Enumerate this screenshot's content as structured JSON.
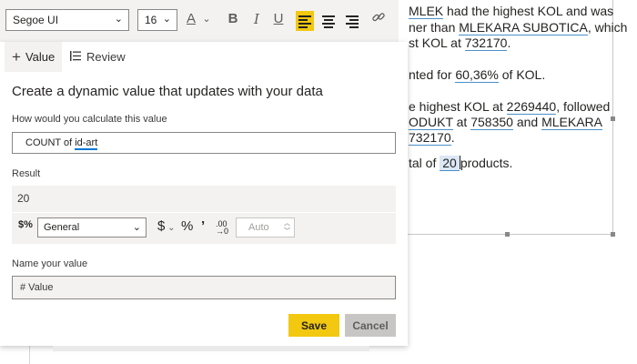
{
  "toolbar": {
    "font_family": "Segoe UI",
    "font_size": "16",
    "font_color_glyph": "A",
    "bold_glyph": "B",
    "italic_glyph": "I",
    "underline_glyph": "U",
    "icons": [
      "font-color-icon",
      "bold-icon",
      "italic-icon",
      "underline-icon",
      "align-left-icon",
      "align-center-icon",
      "align-right-icon",
      "link-icon"
    ],
    "active_color": "#f2c811"
  },
  "background_text": {
    "line1": {
      "a": "MLEK",
      "b": " had the highest KOL and was"
    },
    "line2": {
      "a": "ner than ",
      "b": "MLEKARA SUBOTICA",
      "c": ", which"
    },
    "line3": {
      "a": "st KOL at ",
      "b": "732170",
      "c": "."
    },
    "line4": {
      "a": "nted for ",
      "b": "60,36%",
      "c": " of KOL."
    },
    "line5": {
      "a": "e highest KOL at ",
      "b": "2269440",
      "c": ", followed"
    },
    "line6": {
      "a": "ODUKT",
      "b": " at ",
      "c": "758350",
      "d": " and ",
      "e": "MLEKARA"
    },
    "line7": {
      "a": "732170",
      "b": "."
    },
    "line8": {
      "a": "tal of ",
      "b": "20",
      "c": "products."
    }
  },
  "dialog": {
    "tabs": [
      {
        "label": "Value",
        "icon": "plus-icon"
      },
      {
        "label": "Review",
        "icon": "list-icon"
      }
    ],
    "heading": "Create a dynamic value that updates with your data",
    "calc_label": "How would you calculate this value",
    "calc_value": {
      "prefix": "COUNT of ",
      "field": "id-art"
    },
    "result_label": "Result",
    "result_value": "20",
    "format": {
      "selected": "General",
      "currency_glyph": "$",
      "percent_glyph": "%",
      "comma_glyph": "’",
      "decimals_placeholder": "Auto"
    },
    "name_label": "Name your value",
    "name_value": "# Value",
    "save_label": "Save",
    "cancel_label": "Cancel"
  }
}
